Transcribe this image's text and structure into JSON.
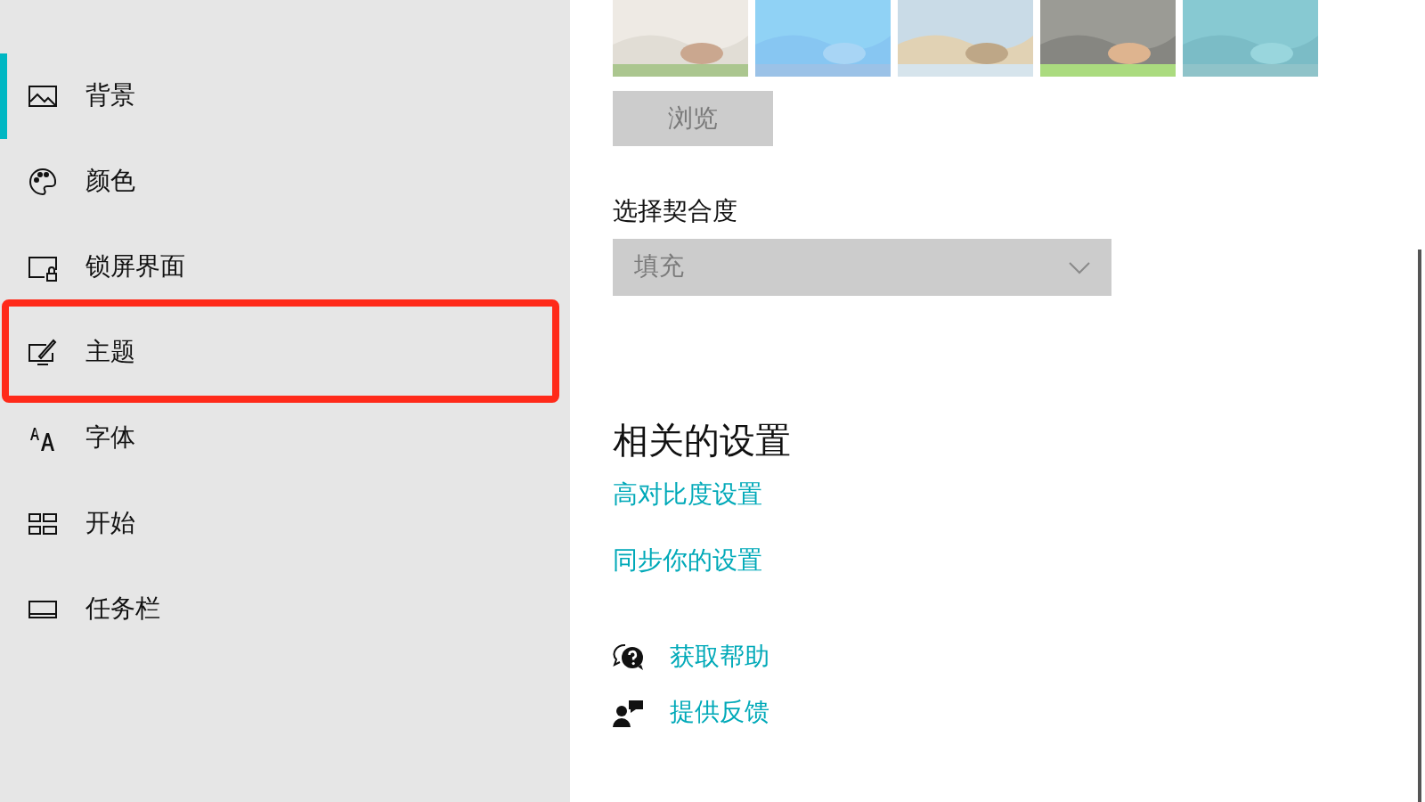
{
  "sidebar": {
    "items": [
      {
        "label": "背景",
        "selected": true,
        "kind": "picture"
      },
      {
        "label": "颜色",
        "selected": false,
        "kind": "palette"
      },
      {
        "label": "锁屏界面",
        "selected": false,
        "kind": "lock"
      },
      {
        "label": "主题",
        "selected": false,
        "kind": "brush",
        "highlighted": true
      },
      {
        "label": "字体",
        "selected": false,
        "kind": "font"
      },
      {
        "label": "开始",
        "selected": false,
        "kind": "grid"
      },
      {
        "label": "任务栏",
        "selected": false,
        "kind": "taskbar"
      }
    ]
  },
  "browse_button": {
    "label": "浏览",
    "disabled": true
  },
  "fit": {
    "label": "选择契合度",
    "value": "填充",
    "disabled": true
  },
  "related": {
    "heading": "相关的设置",
    "links": [
      "高对比度设置",
      "同步你的设置"
    ]
  },
  "help": [
    {
      "kind": "help",
      "label": "获取帮助"
    },
    {
      "kind": "feedback",
      "label": "提供反馈"
    }
  ]
}
